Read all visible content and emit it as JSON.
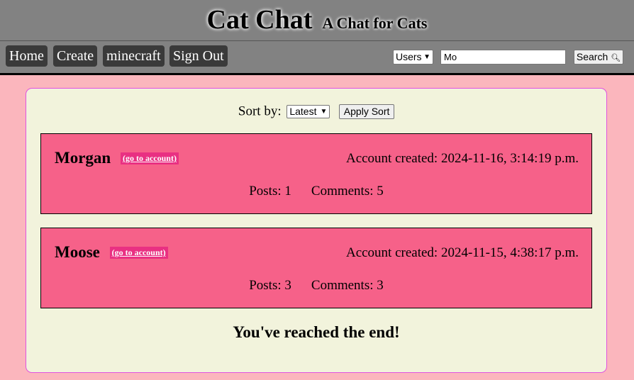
{
  "header": {
    "title": "Cat Chat",
    "subtitle": "A Chat for Cats"
  },
  "nav": {
    "items": [
      {
        "label": "Home"
      },
      {
        "label": "Create"
      },
      {
        "label": "minecraft"
      },
      {
        "label": "Sign Out"
      }
    ]
  },
  "search": {
    "type_selected": "Users",
    "query": "Mo",
    "button_label": "Search",
    "button_icon": "magnifier-icon"
  },
  "sort": {
    "label": "Sort by:",
    "selected": "Latest",
    "button_label": "Apply Sort"
  },
  "results": [
    {
      "username": "Morgan",
      "link_label": "(go to account)",
      "created": "Account created: 2024-11-16, 3:14:19 p.m.",
      "posts": "Posts: 1",
      "comments": "Comments: 5"
    },
    {
      "username": "Moose",
      "link_label": "(go to account)",
      "created": "Account created: 2024-11-15, 4:38:17 p.m.",
      "posts": "Posts: 3",
      "comments": "Comments: 3"
    }
  ],
  "end_message": "You've reached the end!",
  "colors": {
    "page_background": "#fbb6bd",
    "header_background": "#828282",
    "nav_button": "#3a3a3a",
    "panel_background": "#f2f3dc",
    "panel_border": "#e052e0",
    "card_background": "#f66189",
    "link_background": "#e93082"
  }
}
